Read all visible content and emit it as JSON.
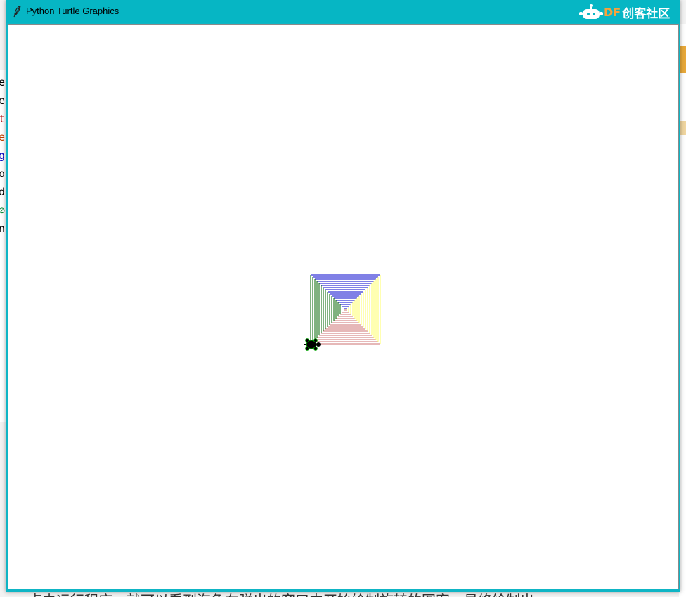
{
  "window": {
    "title": "Python Turtle Graphics",
    "title_icon": "feather-icon",
    "watermark": {
      "prefix": "DF",
      "text": "创客社区",
      "icon": "robot-icon"
    }
  },
  "background": {
    "left_glyphs": [
      "e",
      "e",
      "t",
      "e",
      "g",
      "o",
      "d",
      "⊘",
      "n"
    ],
    "left_colors": [
      "#000000",
      "#000000",
      "#b00000",
      "#c04000",
      "#0000c0",
      "#000000",
      "#000000",
      "#0a8a3a",
      "#000000"
    ],
    "bottom_text": "点击运行程序，就可以看到海龟在弹出的窗口中开始绘制旋转的图案，最终绘制出"
  },
  "drawing": {
    "shape": "square of four triangles",
    "triangle_colors": {
      "top": "#0000cc",
      "right": "#ffff66",
      "bottom": "#cc7070",
      "left": "#006600"
    },
    "turtle_color": "#000000",
    "turtle_outline": "#00aa00"
  }
}
